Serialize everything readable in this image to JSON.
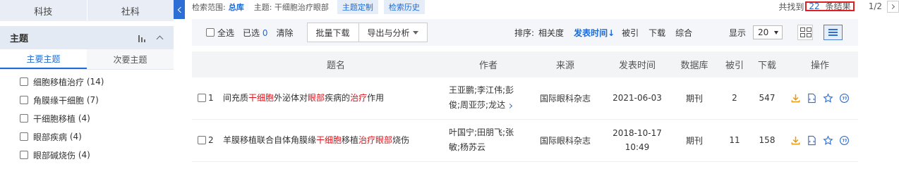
{
  "sidebar": {
    "category_tabs": [
      "科技",
      "社科"
    ],
    "theme_title": "主题",
    "sub_tabs": [
      "主要主题",
      "次要主题"
    ],
    "facets": [
      {
        "label": "细胞移植治疗",
        "count": "(14)"
      },
      {
        "label": "角膜缘干细胞",
        "count": "(7)"
      },
      {
        "label": "干细胞移植",
        "count": "(4)"
      },
      {
        "label": "眼部疾病",
        "count": "(4)"
      },
      {
        "label": "眼部碱烧伤",
        "count": "(4)"
      }
    ]
  },
  "scope": {
    "label": "检索范围:",
    "database": "总库",
    "topic": "主题: 干细胞治疗眼部",
    "custom_label": "主题定制",
    "history_label": "检索历史"
  },
  "results_info": {
    "prefix": "共找到",
    "count": "22",
    "suffix": "条结果",
    "page": "1/2"
  },
  "toolbar": {
    "select_all": "全选",
    "selected_label": "已选",
    "selected_count": "0",
    "clear": "清除",
    "batch_download": "批量下载",
    "export": "导出与分析",
    "sort_label": "排序:",
    "sort_options": [
      "相关度",
      "发表时间↓",
      "被引",
      "下载",
      "综合"
    ],
    "show_label": "显示",
    "page_size": "20"
  },
  "table": {
    "headers": [
      "题名",
      "作者",
      "来源",
      "发表时间",
      "数据库",
      "被引",
      "下载",
      "操作"
    ],
    "rows": [
      {
        "index": "1",
        "title_parts": [
          {
            "text": "间充质",
            "hl": false
          },
          {
            "text": "干细胞",
            "hl": true
          },
          {
            "text": "外泌体对",
            "hl": false
          },
          {
            "text": "眼部",
            "hl": true
          },
          {
            "text": "疾病的",
            "hl": false
          },
          {
            "text": "治疗",
            "hl": true
          },
          {
            "text": "作用",
            "hl": false
          }
        ],
        "authors_line1": "王亚鹏;李江伟;彭",
        "authors_line2": "俊;周亚莎;龙达",
        "source": "国际眼科杂志",
        "date": "2021-06-03",
        "date_time": "",
        "database": "期刊",
        "cited": "2",
        "downloads": "547"
      },
      {
        "index": "2",
        "title_parts": [
          {
            "text": "羊膜移植联合自体角膜缘",
            "hl": false
          },
          {
            "text": "干细胞",
            "hl": true
          },
          {
            "text": "移植",
            "hl": false
          },
          {
            "text": "治疗眼部",
            "hl": true
          },
          {
            "text": "烧伤",
            "hl": false
          }
        ],
        "authors_line1": "叶国宁;田朋飞;张",
        "authors_line2": "敏;杨苏云",
        "source": "国际眼科杂志",
        "date": "2018-10-17",
        "date_time": "10:49",
        "database": "期刊",
        "cited": "11",
        "downloads": "158"
      }
    ]
  },
  "icons": [
    "bar-chart-icon",
    "chevron-up-icon",
    "collapse-left-icon",
    "download-icon",
    "html-read-icon",
    "favorite-star-icon",
    "quote-icon",
    "grid-view-icon",
    "list-view-icon"
  ],
  "colors": {
    "accent": "#1e6bd6",
    "highlight": "#e0121b",
    "result_box": "#e02020"
  }
}
